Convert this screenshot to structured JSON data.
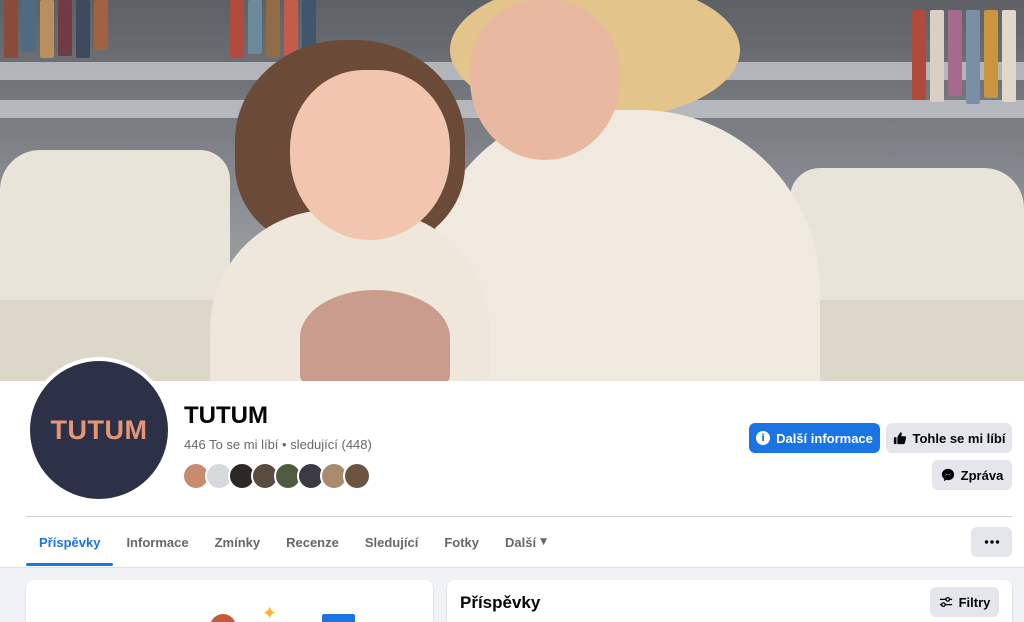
{
  "page": {
    "name": "TUTUM",
    "avatar_text": "TUTUM",
    "stats": "446 To se mi líbí • sledující (448)",
    "follower_faces": 8
  },
  "actions": {
    "more_info": "Další informace",
    "like": "Tohle se mi líbí",
    "message": "Zpráva"
  },
  "tabs": [
    {
      "label": "Příspěvky",
      "active": true
    },
    {
      "label": "Informace"
    },
    {
      "label": "Zmínky"
    },
    {
      "label": "Recenze"
    },
    {
      "label": "Sledující"
    },
    {
      "label": "Fotky"
    },
    {
      "label": "Další"
    }
  ],
  "posts": {
    "title": "Příspěvky",
    "filter_label": "Filtry"
  },
  "colors": {
    "accent": "#1b74e4",
    "avatar_bg": "#2d3148",
    "avatar_text": "#e69577"
  },
  "icons": {
    "more_info": "info-icon",
    "like": "thumbs-up-icon",
    "message": "messenger-icon",
    "tab_more": "caret-down-icon",
    "more": "ellipsis-icon",
    "filter": "sliders-icon"
  }
}
